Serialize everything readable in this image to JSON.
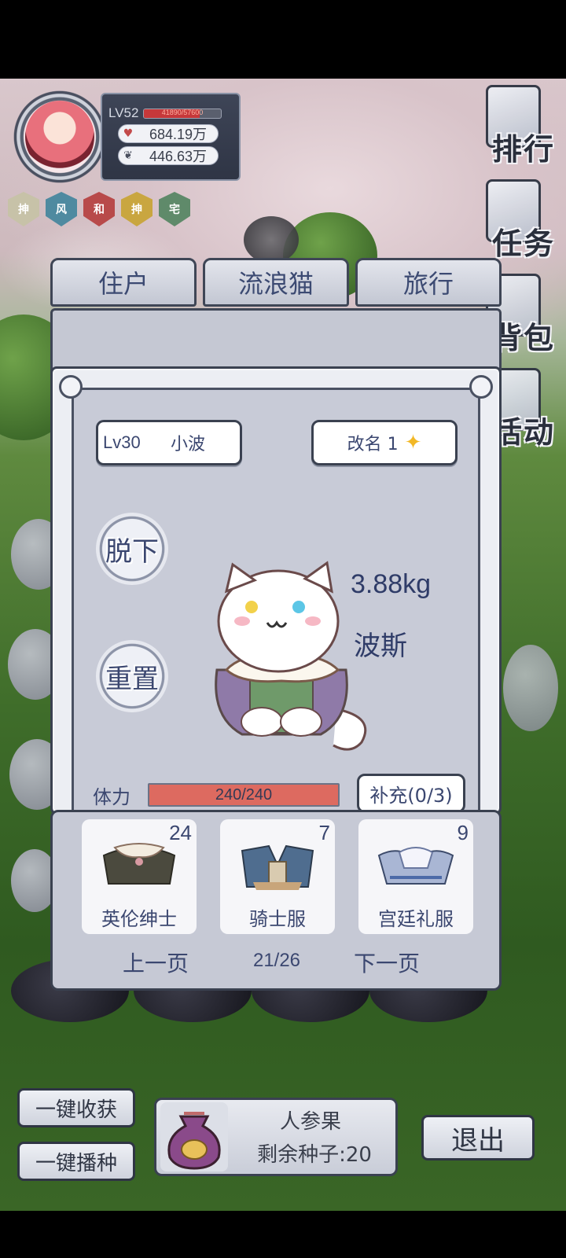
{
  "player": {
    "level": "LV52",
    "exp_text": "41890/57600",
    "exp_progress": 0.727,
    "currency1": "684.19万",
    "currency2": "446.63万"
  },
  "badges": [
    {
      "label": "抻",
      "color": "#c7c2a8"
    },
    {
      "label": "风",
      "color": "#4f8aa0"
    },
    {
      "label": "和",
      "color": "#b84a4a"
    },
    {
      "label": "抻",
      "color": "#c9a640"
    },
    {
      "label": "宅",
      "color": "#5f8a6a"
    }
  ],
  "side_menu": [
    "排行",
    "任务",
    "背包",
    "活动"
  ],
  "tabs": [
    "住户",
    "流浪猫",
    "旅行"
  ],
  "cat": {
    "level": "Lv30",
    "name": "小波",
    "rename_label": "改名 1",
    "weight": "3.88kg",
    "breed": "波斯",
    "take_off_label": "脱下",
    "reset_label": "重置",
    "stamina_label": "体力",
    "stamina_text": "240/240",
    "stamina_fraction": 1.0,
    "refill_label": "补充(0/3)"
  },
  "costumes": [
    {
      "name": "英伦绅士",
      "count": "24"
    },
    {
      "name": "骑士服",
      "count": "7"
    },
    {
      "name": "宫廷礼服",
      "count": "9"
    }
  ],
  "pager": {
    "prev": "上一页",
    "page": "21/26",
    "next": "下一页"
  },
  "bottom": {
    "harvest_all": "一键收获",
    "sow_all": "一键播种",
    "seed_name": "人参果",
    "seeds_left": "剩余种子:20",
    "exit": "退出"
  }
}
